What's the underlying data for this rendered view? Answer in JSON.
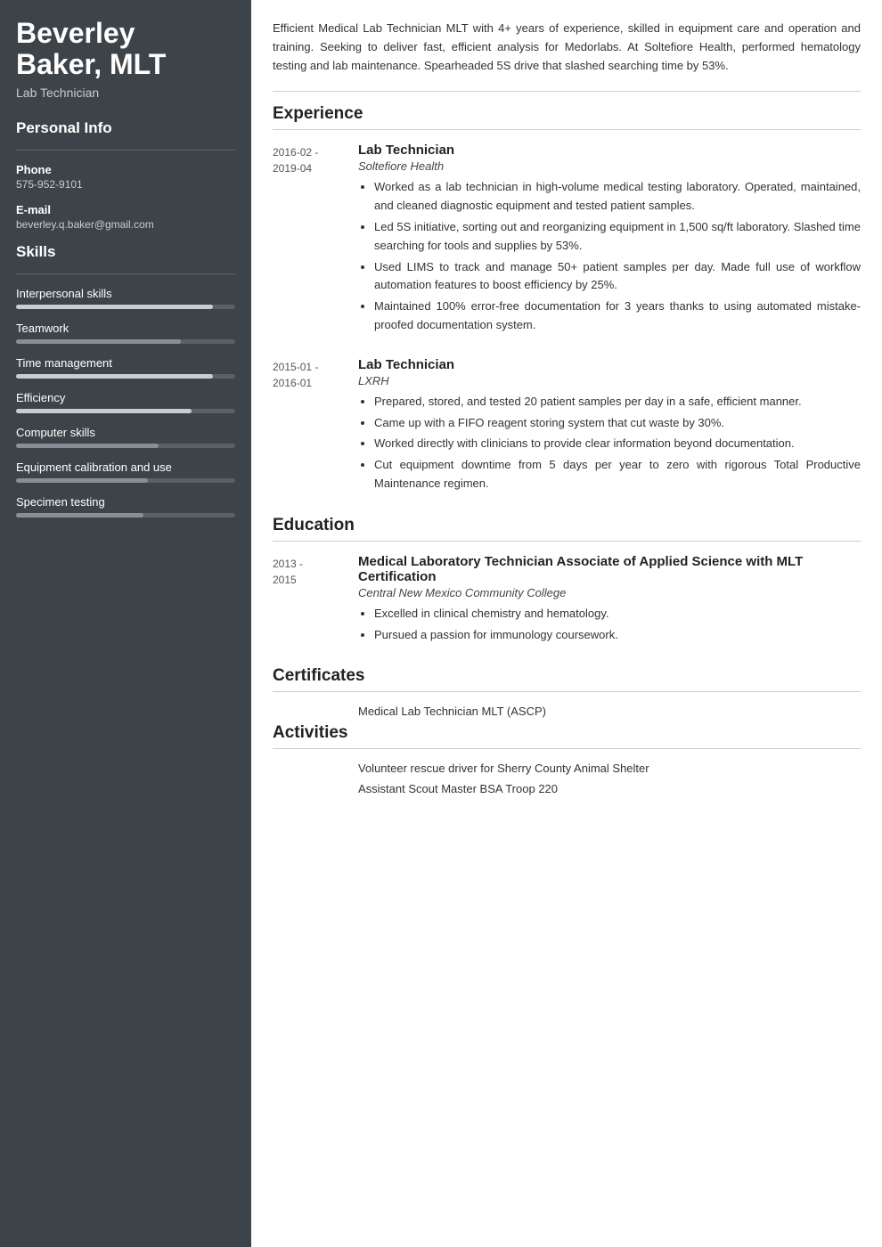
{
  "sidebar": {
    "name": "Beverley Baker, MLT",
    "name_line1": "Beverley",
    "name_line2": "Baker, MLT",
    "title": "Lab Technician",
    "personal_info_heading": "Personal Info",
    "phone_label": "Phone",
    "phone_value": "575-952-9101",
    "email_label": "E-mail",
    "email_value": "beverley.q.baker@gmail.com",
    "skills_heading": "Skills",
    "skills": [
      {
        "name": "Interpersonal skills",
        "percent": 90,
        "type": "light"
      },
      {
        "name": "Teamwork",
        "percent": 75,
        "type": "dark"
      },
      {
        "name": "Time management",
        "percent": 90,
        "type": "light"
      },
      {
        "name": "Efficiency",
        "percent": 80,
        "type": "light"
      },
      {
        "name": "Computer skills",
        "percent": 65,
        "type": "dark"
      },
      {
        "name": "Equipment calibration and use",
        "percent": 60,
        "type": "dark"
      },
      {
        "name": "Specimen testing",
        "percent": 58,
        "type": "dark"
      }
    ]
  },
  "main": {
    "summary": "Efficient Medical Lab Technician MLT with 4+ years of experience, skilled in equipment care and operation and training. Seeking to deliver fast, efficient analysis for Medorlabs. At Soltefiore Health, performed hematology testing and lab maintenance. Spearheaded 5S drive that slashed searching time by 53%.",
    "experience_heading": "Experience",
    "jobs": [
      {
        "date": "2016-02 -\n2019-04",
        "title": "Lab Technician",
        "company": "Soltefiore Health",
        "bullets": [
          "Worked as a lab technician in high-volume medical testing laboratory. Operated, maintained, and cleaned diagnostic equipment and tested patient samples.",
          "Led 5S initiative, sorting out and reorganizing equipment in 1,500 sq/ft laboratory. Slashed time searching for tools and supplies by 53%.",
          "Used LIMS to track and manage 50+ patient samples per day. Made full use of workflow automation features to boost efficiency by 25%.",
          "Maintained 100% error-free documentation for 3 years thanks to using automated mistake-proofed documentation system."
        ]
      },
      {
        "date": "2015-01 -\n2016-01",
        "title": "Lab Technician",
        "company": "LXRH",
        "bullets": [
          "Prepared, stored, and tested 20 patient samples per day in a safe, efficient manner.",
          "Came up with a FIFO reagent storing system that cut waste by 30%.",
          "Worked directly with clinicians to provide clear information beyond documentation.",
          "Cut equipment downtime from 5 days per year to zero with rigorous Total Productive Maintenance regimen."
        ]
      }
    ],
    "education_heading": "Education",
    "education": [
      {
        "date": "2013 -\n2015",
        "degree": "Medical Laboratory Technician Associate of Applied Science with MLT Certification",
        "school": "Central New Mexico Community College",
        "bullets": [
          "Excelled in clinical chemistry and hematology.",
          "Pursued a passion for immunology coursework."
        ]
      }
    ],
    "certificates_heading": "Certificates",
    "certificates": [
      "Medical Lab Technician MLT (ASCP)"
    ],
    "activities_heading": "Activities",
    "activities": [
      "Volunteer rescue driver for Sherry County Animal Shelter",
      "Assistant Scout Master BSA Troop 220"
    ]
  }
}
